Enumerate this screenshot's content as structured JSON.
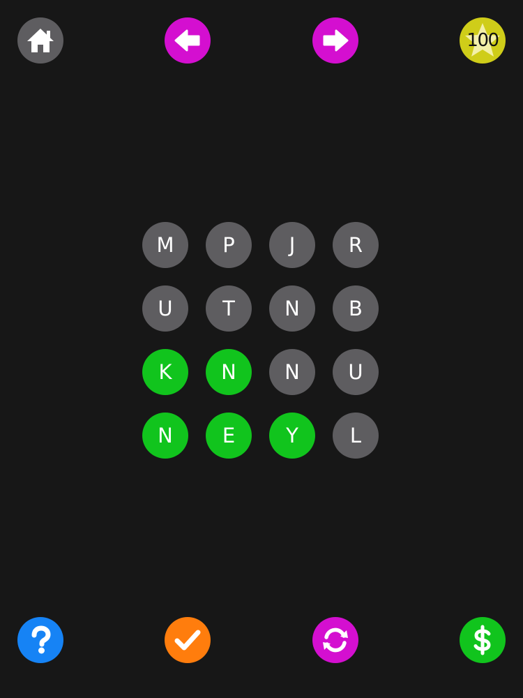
{
  "colors": {
    "background": "#171717",
    "tile_default": "#5e5d60",
    "tile_selected": "#11c41d",
    "home": "#5e5d60",
    "nav_arrows": "#d40fd0",
    "coins": "#cfcd19",
    "help": "#1683f5",
    "check": "#ff7d0d",
    "shuffle": "#d40fd0",
    "shop": "#11c41d"
  },
  "toolbar": {
    "home_icon": "home-icon",
    "prev_icon": "arrow-left-icon",
    "next_icon": "arrow-right-icon",
    "coins_icon": "star-icon",
    "coins": "100"
  },
  "bottom_bar": {
    "help_icon": "question-mark-icon",
    "check_icon": "checkmark-icon",
    "shuffle_icon": "refresh-icon",
    "shop_icon": "dollar-icon"
  },
  "board": {
    "rows": [
      [
        {
          "letter": "M",
          "selected": false
        },
        {
          "letter": "P",
          "selected": false
        },
        {
          "letter": "J",
          "selected": false
        },
        {
          "letter": "R",
          "selected": false
        }
      ],
      [
        {
          "letter": "U",
          "selected": false
        },
        {
          "letter": "T",
          "selected": false
        },
        {
          "letter": "N",
          "selected": false
        },
        {
          "letter": "B",
          "selected": false
        }
      ],
      [
        {
          "letter": "K",
          "selected": true
        },
        {
          "letter": "N",
          "selected": true
        },
        {
          "letter": "N",
          "selected": false
        },
        {
          "letter": "U",
          "selected": false
        }
      ],
      [
        {
          "letter": "N",
          "selected": true
        },
        {
          "letter": "E",
          "selected": true
        },
        {
          "letter": "Y",
          "selected": true
        },
        {
          "letter": "L",
          "selected": false
        }
      ]
    ]
  }
}
